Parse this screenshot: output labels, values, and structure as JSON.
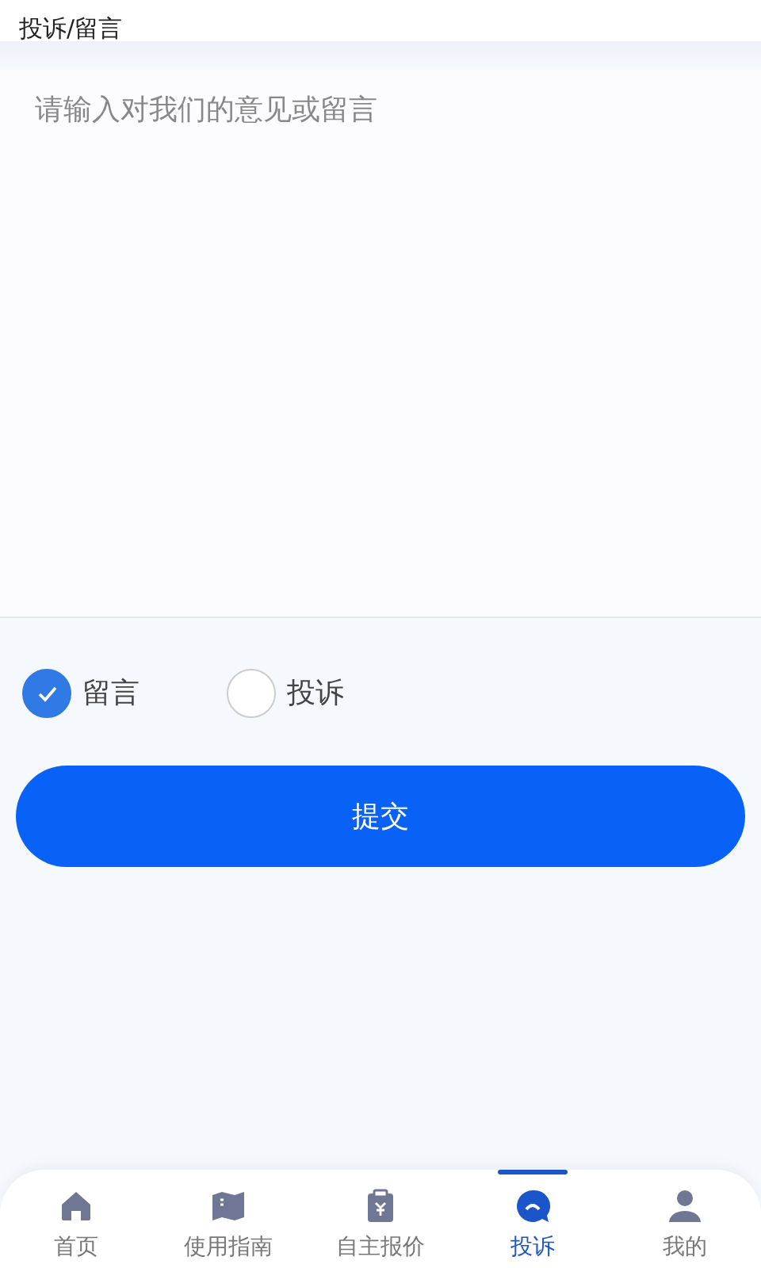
{
  "header": {
    "title": "投诉/留言"
  },
  "message_field": {
    "placeholder": "请输入对我们的意见或留言"
  },
  "types": [
    {
      "label": "留言",
      "selected": true
    },
    {
      "label": "投诉",
      "selected": false
    }
  ],
  "submit_button": "提交",
  "tab_bar": [
    {
      "label": "首页",
      "kind": "home",
      "selected": false
    },
    {
      "label": "使用指南",
      "kind": "guide",
      "selected": false
    },
    {
      "label": "自主报价",
      "kind": "quote",
      "selected": false
    },
    {
      "label": "投诉",
      "kind": "complaint",
      "selected": true
    },
    {
      "label": "我的",
      "kind": "profile",
      "selected": false
    }
  ]
}
